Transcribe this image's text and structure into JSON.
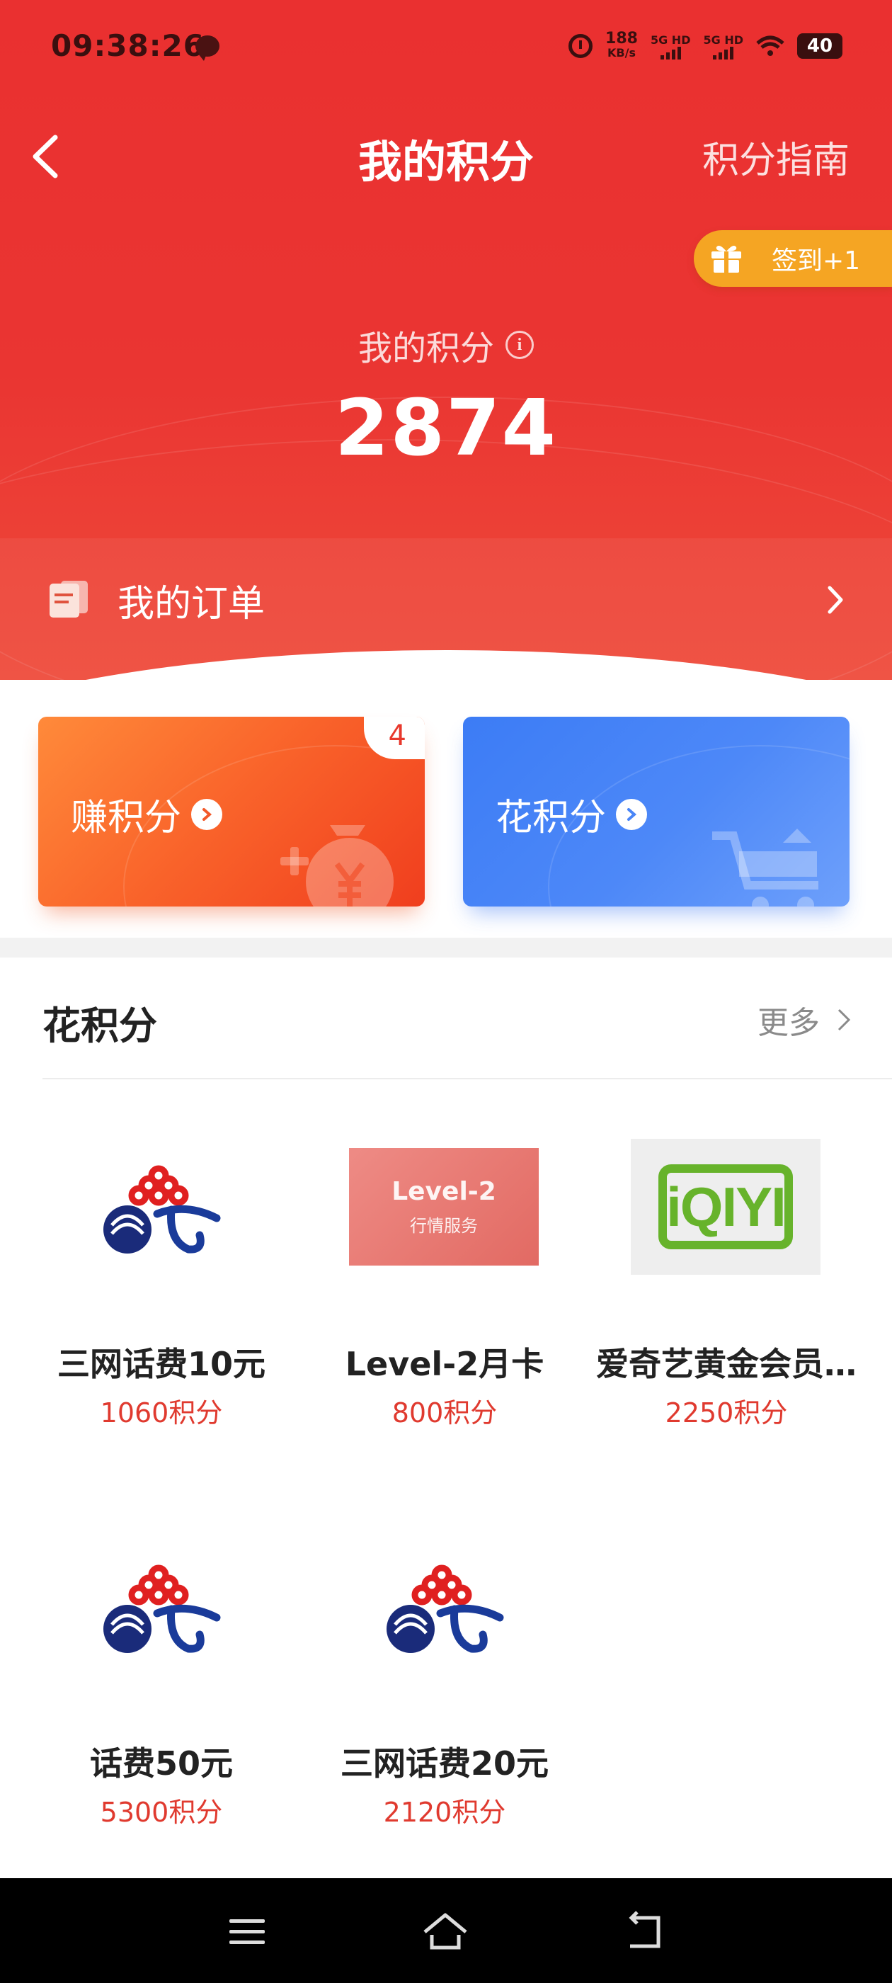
{
  "status_bar": {
    "time": "09:38:26",
    "speed_value": "188",
    "speed_unit": "KB/s",
    "sim1": "5G HD",
    "sim2": "5G HD",
    "battery": "40"
  },
  "header": {
    "title": "我的积分",
    "guide_link": "积分指南",
    "signin_label": "签到+1"
  },
  "points": {
    "label": "我的积分",
    "value": "2874"
  },
  "orders": {
    "label": "我的订单"
  },
  "cards": {
    "earn_label": "赚积分",
    "earn_badge": "4",
    "spend_label": "花积分"
  },
  "section": {
    "title": "花积分",
    "more": "更多"
  },
  "products": [
    {
      "name": "三网话费10元",
      "price": "1060积分",
      "image": "carrier-logos"
    },
    {
      "name": "Level-2月卡",
      "price": "800积分",
      "image": "level2-card",
      "image_title": "Level-2",
      "image_subtitle": "行情服务"
    },
    {
      "name": "爱奇艺黄金会员…",
      "price": "2250积分",
      "image": "iqiyi-logo",
      "image_text": "iQIYI"
    },
    {
      "name": "话费50元",
      "price": "5300积分",
      "image": "carrier-logos"
    },
    {
      "name": "三网话费20元",
      "price": "2120积分",
      "image": "carrier-logos"
    }
  ],
  "colors": {
    "header_red": "#ea3030",
    "earn_orange": "#f9622a",
    "spend_blue": "#4d88f8",
    "price_red": "#e03a2f",
    "signin_yellow": "#f5a523"
  },
  "icons": [
    "back-icon",
    "gift-icon",
    "info-icon",
    "order-icon",
    "chevron-right-icon",
    "money-bag-icon",
    "cart-icon",
    "menu-icon",
    "home-icon",
    "return-icon"
  ]
}
